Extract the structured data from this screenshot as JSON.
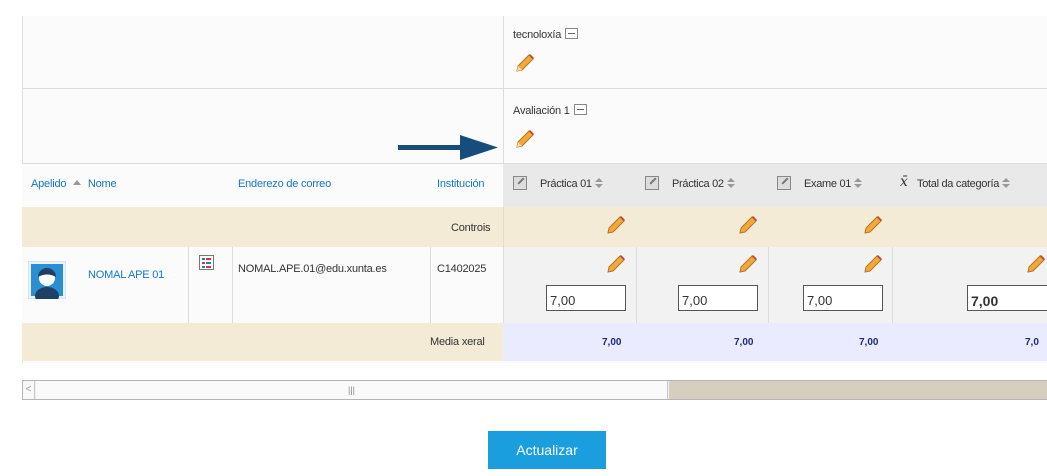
{
  "categories": {
    "top": "tecnoloxía",
    "sub": "Avaliación 1"
  },
  "header": {
    "surname": "Apelido",
    "name": "Nome",
    "email": "Enderezo de correo",
    "institution": "Institución",
    "items": [
      "Práctica 01",
      "Práctica 02",
      "Exame 01",
      "Total da categoría"
    ]
  },
  "controls_label": "Controis",
  "student": {
    "name": "NOMAL APE 01",
    "email": "NOMAL.APE.01@edu.xunta.es",
    "institution": "C1402025",
    "grades": [
      "7,00",
      "7,00",
      "7,00",
      "7,00"
    ]
  },
  "average": {
    "label": "Media xeral",
    "values": [
      "7,00",
      "7,00",
      "7,00",
      "7,0"
    ]
  },
  "scrollbar": {
    "grip": "|||"
  },
  "update_button": "Actualizar",
  "colors": {
    "link": "#1177d1",
    "button": "#1a9edd",
    "controls_row": "#f3ebd6",
    "average_highlight": "#ebebff",
    "arrow": "#174d7c"
  }
}
